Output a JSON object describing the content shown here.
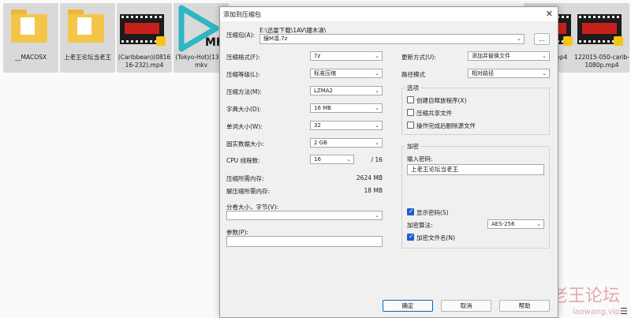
{
  "explorer": {
    "tiles": [
      {
        "caption": "__MACOSX",
        "kind": "folder"
      },
      {
        "caption": "上老王论坛当老王",
        "kind": "folder"
      },
      {
        "caption": "(Caribbean)(081616-232).mp4",
        "kind": "video"
      },
      {
        "caption": "(Tokyo-Hot)(138).mkv",
        "kind": "mkv"
      },
      {
        "caption": "-car-...mp4",
        "kind": "video"
      },
      {
        "caption": "122015-050-carib-1080p.mp4",
        "kind": "video"
      }
    ],
    "mkv_label": "MKV",
    "watermark": "老王论坛",
    "watermark_sub": "laowang.vip"
  },
  "dialog": {
    "title": "添加到压缩包",
    "close": "✕",
    "archive": {
      "label": "压缩包(A):",
      "path": "E:\\迅雷下载\\1AV\\鐘木凛\\",
      "name": "鐘M凛.7z",
      "browse": "..."
    },
    "left": {
      "format_label": "压缩格式(F):",
      "format_value": "7z",
      "level_label": "压缩等级(L):",
      "level_value": "标准压缩",
      "method_label": "压缩方法(M):",
      "method_value": "LZMA2",
      "dict_label": "字典大小(D):",
      "dict_value": "16 MB",
      "word_label": "单词大小(W):",
      "word_value": "32",
      "solid_label": "固实数据大小:",
      "solid_value": "2 GB",
      "cpu_label": "CPU 线程数:",
      "cpu_value": "16",
      "cpu_total": "/ 16",
      "mem_c_label": "压缩所需内存:",
      "mem_c_value": "2624 MB",
      "mem_d_label": "解压缩所需内存:",
      "mem_d_value": "18 MB",
      "split_label": "分卷大小，字节(V):",
      "split_value": "",
      "params_label": "参数(P):",
      "params_value": ""
    },
    "right": {
      "update_label": "更新方式(U):",
      "update_value": "添加并替换文件",
      "path_label": "路径模式",
      "path_value": "相对路径",
      "options_title": "选项",
      "opt_sfx": "创建自释放程序(X)",
      "opt_shared": "压缩共享文件",
      "opt_delete": "操作完成后删除源文件",
      "enc_title": "加密",
      "pwd_label": "输入密码:",
      "pwd_value": "上老王论坛当老王",
      "show_pwd": "显示密码(S)",
      "enc_method_label": "加密算法:",
      "enc_method_value": "AES-256",
      "enc_names": "加密文件名(N)"
    },
    "buttons": {
      "ok": "确定",
      "cancel": "取消",
      "help": "帮助"
    }
  }
}
